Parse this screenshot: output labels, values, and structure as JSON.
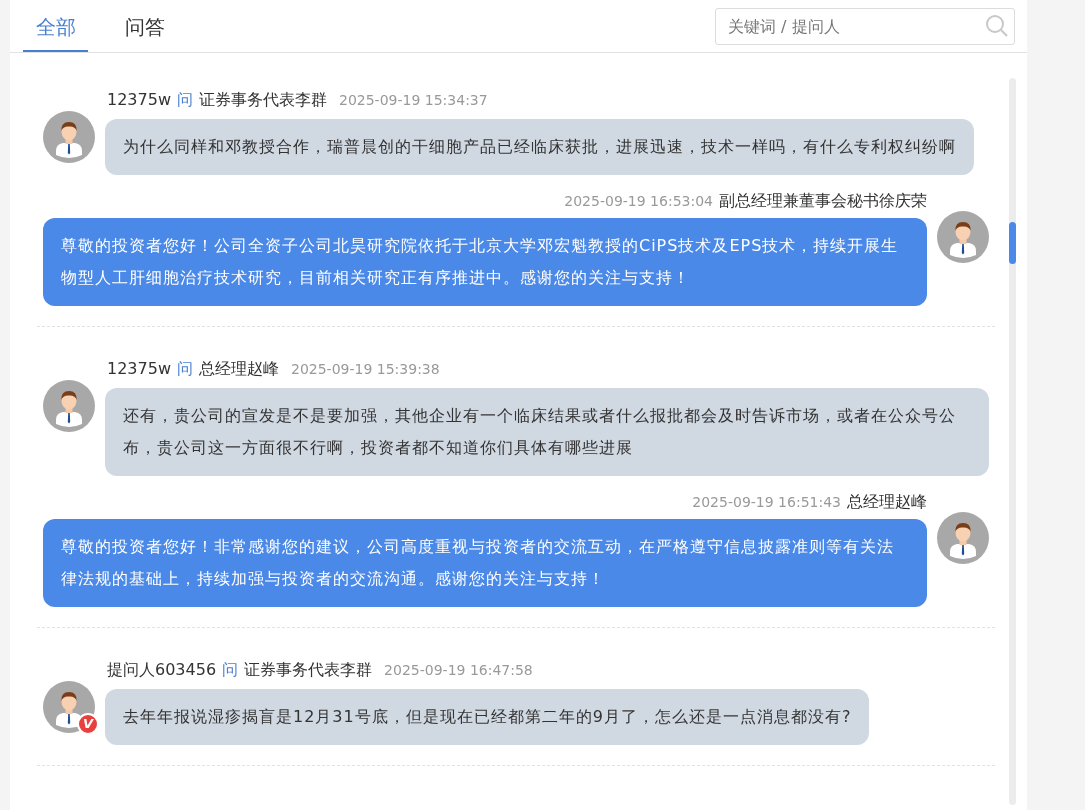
{
  "tabs": [
    {
      "label": "全部",
      "selected": true
    },
    {
      "label": "问答",
      "selected": false
    }
  ],
  "search": {
    "placeholder": "关键词 / 提问人"
  },
  "threads": [
    {
      "question": {
        "asker": "12375w",
        "ask_mark": "问",
        "addressee": "证券事务代表李群",
        "time": "2025-09-19 15:34:37",
        "text": "为什么同样和邓教授合作，瑞普晨创的干细胞产品已经临床获批，进展迅速，技术一样吗，有什么专利权纠纷啊"
      },
      "answer": {
        "time": "2025-09-19 16:53:04",
        "responder": "副总经理兼董事会秘书徐庆荣",
        "text": "尊敬的投资者您好！公司全资子公司北昊研究院依托于北京大学邓宏魁教授的CiPS技术及EPS技术，持续开展生物型人工肝细胞治疗技术研究，目前相关研究正有序推进中。感谢您的关注与支持！"
      }
    },
    {
      "question": {
        "asker": "12375w",
        "ask_mark": "问",
        "addressee": "总经理赵峰",
        "time": "2025-09-19 15:39:38",
        "text": "还有，贵公司的宣发是不是要加强，其他企业有一个临床结果或者什么报批都会及时告诉市场，或者在公众号公布，贵公司这一方面很不行啊，投资者都不知道你们具体有哪些进展"
      },
      "answer": {
        "time": "2025-09-19 16:51:43",
        "responder": "总经理赵峰",
        "text": "尊敬的投资者您好！非常感谢您的建议，公司高度重视与投资者的交流互动，在严格遵守信息披露准则等有关法律法规的基础上，持续加强与投资者的交流沟通。感谢您的关注与支持！"
      }
    },
    {
      "question": {
        "asker": "提问人603456",
        "badge": "V",
        "ask_mark": "问",
        "addressee": "证券事务代表李群",
        "time": "2025-09-19 16:47:58",
        "text": "去年年报说湿疹揭盲是12月31号底，但是现在已经都第二年的9月了，怎么还是一点消息都没有?"
      }
    }
  ]
}
